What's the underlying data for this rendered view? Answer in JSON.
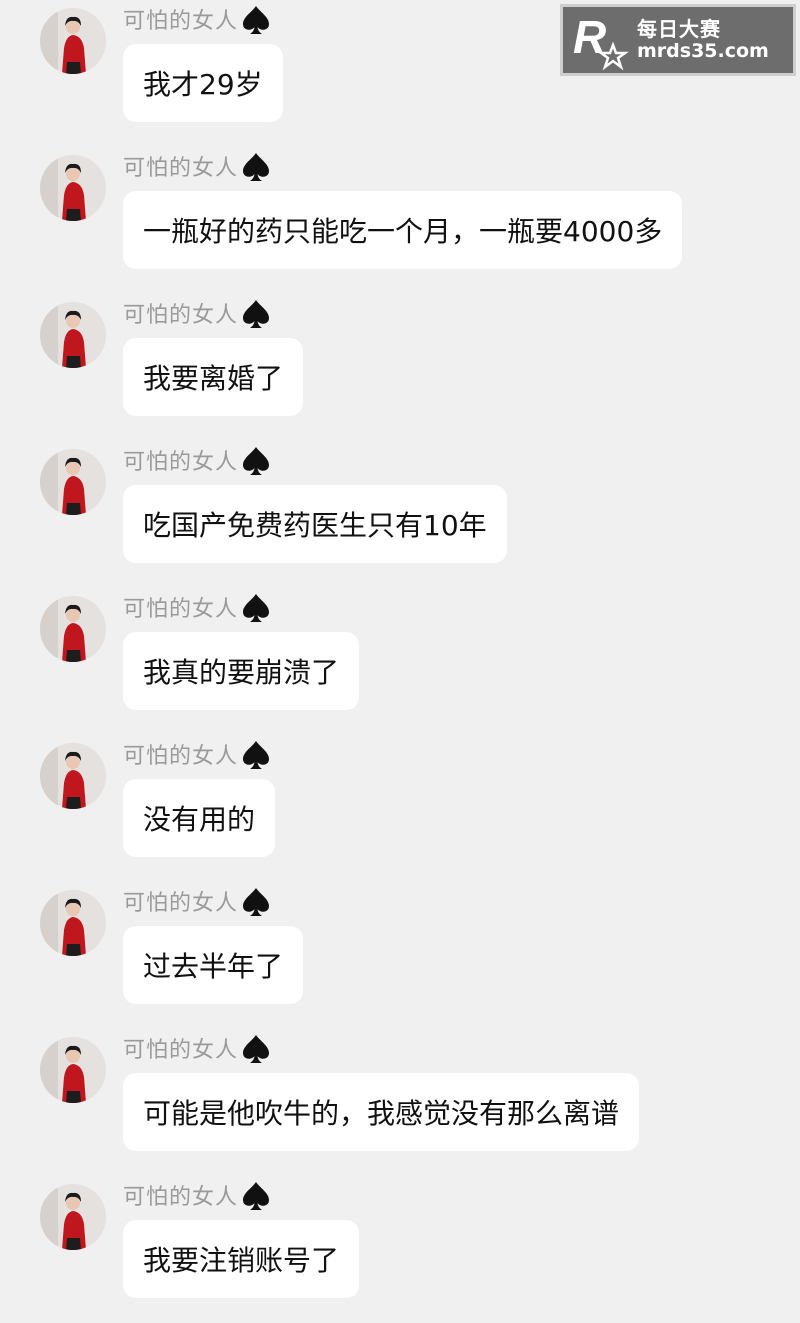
{
  "watermark": {
    "brand_line1": "每日大赛",
    "brand_line2": "mrds35.com"
  },
  "messages": [
    {
      "sender": "可怕的女人",
      "text": "我才29岁"
    },
    {
      "sender": "可怕的女人",
      "text": "一瓶好的药只能吃一个月，一瓶要4000多"
    },
    {
      "sender": "可怕的女人",
      "text": "我要离婚了"
    },
    {
      "sender": "可怕的女人",
      "text": "吃国产免费药医生只有10年"
    },
    {
      "sender": "可怕的女人",
      "text": "我真的要崩溃了"
    },
    {
      "sender": "可怕的女人",
      "text": "没有用的"
    },
    {
      "sender": "可怕的女人",
      "text": "过去半年了"
    },
    {
      "sender": "可怕的女人",
      "text": "可能是他吹牛的，我感觉没有那么离谱"
    },
    {
      "sender": "可怕的女人",
      "text": "我要注销账号了"
    }
  ],
  "icons": {
    "sender_suffix": "spade-icon",
    "avatar": "avatar-woman-red-top"
  },
  "colors": {
    "background": "#f0f0f0",
    "bubble": "#ffffff",
    "sender_name": "#9a9a9a",
    "text": "#111111"
  }
}
